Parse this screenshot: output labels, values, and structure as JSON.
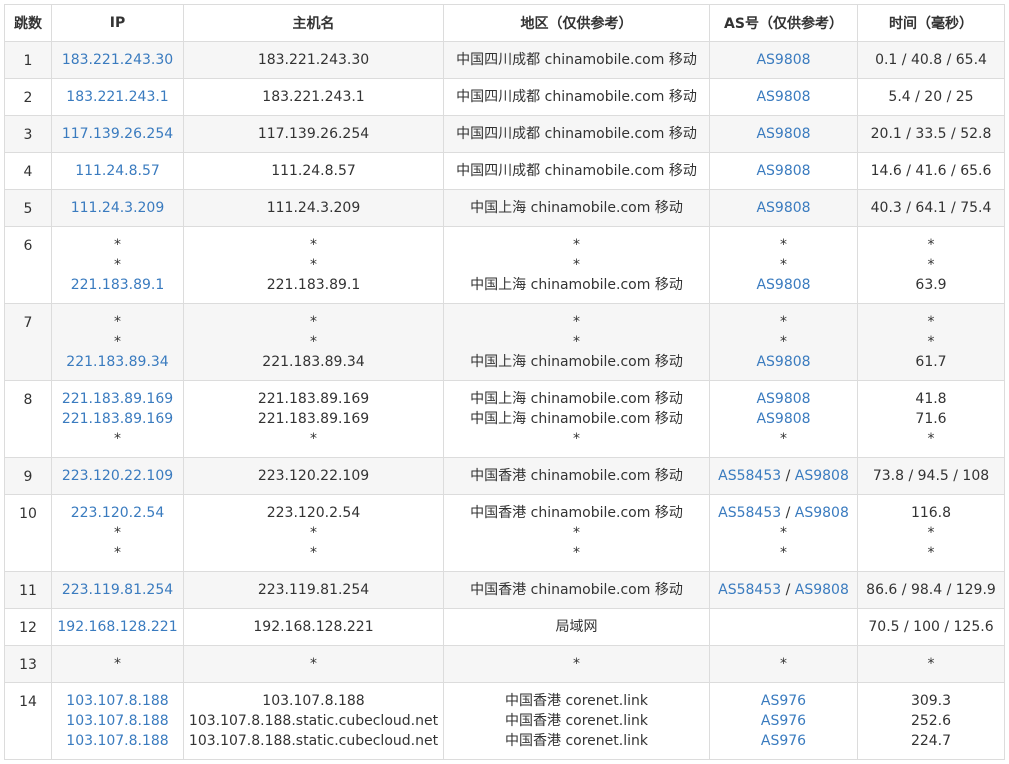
{
  "headers": {
    "hop": "跳数",
    "ip": "IP",
    "host": "主机名",
    "region": "地区（仅供参考）",
    "as": "AS号（仅供参考）",
    "time": "时间（毫秒）"
  },
  "rows": [
    {
      "hop": "1",
      "ip": [
        "183.221.243.30"
      ],
      "host": [
        "183.221.243.30"
      ],
      "region": [
        "中国四川成都 chinamobile.com 移动"
      ],
      "as": [
        [
          "AS9808"
        ]
      ],
      "time": [
        "0.1 / 40.8 / 65.4"
      ]
    },
    {
      "hop": "2",
      "ip": [
        "183.221.243.1"
      ],
      "host": [
        "183.221.243.1"
      ],
      "region": [
        "中国四川成都 chinamobile.com 移动"
      ],
      "as": [
        [
          "AS9808"
        ]
      ],
      "time": [
        "5.4 / 20 / 25"
      ]
    },
    {
      "hop": "3",
      "ip": [
        "117.139.26.254"
      ],
      "host": [
        "117.139.26.254"
      ],
      "region": [
        "中国四川成都 chinamobile.com 移动"
      ],
      "as": [
        [
          "AS9808"
        ]
      ],
      "time": [
        "20.1 / 33.5 / 52.8"
      ]
    },
    {
      "hop": "4",
      "ip": [
        "111.24.8.57"
      ],
      "host": [
        "111.24.8.57"
      ],
      "region": [
        "中国四川成都 chinamobile.com 移动"
      ],
      "as": [
        [
          "AS9808"
        ]
      ],
      "time": [
        "14.6 / 41.6 / 65.6"
      ]
    },
    {
      "hop": "5",
      "ip": [
        "111.24.3.209"
      ],
      "host": [
        "111.24.3.209"
      ],
      "region": [
        "中国上海 chinamobile.com 移动"
      ],
      "as": [
        [
          "AS9808"
        ]
      ],
      "time": [
        "40.3 / 64.1 / 75.4"
      ]
    },
    {
      "hop": "6",
      "ip": [
        "*",
        "*",
        "221.183.89.1"
      ],
      "host": [
        "*",
        "*",
        "221.183.89.1"
      ],
      "region": [
        "*",
        "*",
        "中国上海 chinamobile.com 移动"
      ],
      "as": [
        [
          "*"
        ],
        [
          "*"
        ],
        [
          "AS9808"
        ]
      ],
      "time": [
        "*",
        "*",
        "63.9"
      ]
    },
    {
      "hop": "7",
      "ip": [
        "*",
        "*",
        "221.183.89.34"
      ],
      "host": [
        "*",
        "*",
        "221.183.89.34"
      ],
      "region": [
        "*",
        "*",
        "中国上海 chinamobile.com 移动"
      ],
      "as": [
        [
          "*"
        ],
        [
          "*"
        ],
        [
          "AS9808"
        ]
      ],
      "time": [
        "*",
        "*",
        "61.7"
      ]
    },
    {
      "hop": "8",
      "ip": [
        "221.183.89.169",
        "221.183.89.169",
        "*"
      ],
      "host": [
        "221.183.89.169",
        "221.183.89.169",
        "*"
      ],
      "region": [
        "中国上海 chinamobile.com 移动",
        "中国上海 chinamobile.com 移动",
        "*"
      ],
      "as": [
        [
          "AS9808"
        ],
        [
          "AS9808"
        ],
        [
          "*"
        ]
      ],
      "time": [
        "41.8",
        "71.6",
        "*"
      ]
    },
    {
      "hop": "9",
      "ip": [
        "223.120.22.109"
      ],
      "host": [
        "223.120.22.109"
      ],
      "region": [
        "中国香港 chinamobile.com 移动"
      ],
      "as": [
        [
          "AS58453",
          "AS9808"
        ]
      ],
      "time": [
        "73.8 / 94.5 / 108"
      ]
    },
    {
      "hop": "10",
      "ip": [
        "223.120.2.54",
        "*",
        "*"
      ],
      "host": [
        "223.120.2.54",
        "*",
        "*"
      ],
      "region": [
        "中国香港 chinamobile.com 移动",
        "*",
        "*"
      ],
      "as": [
        [
          "AS58453",
          "AS9808"
        ],
        [
          "*"
        ],
        [
          "*"
        ]
      ],
      "time": [
        "116.8",
        "*",
        "*"
      ]
    },
    {
      "hop": "11",
      "ip": [
        "223.119.81.254"
      ],
      "host": [
        "223.119.81.254"
      ],
      "region": [
        "中国香港 chinamobile.com 移动"
      ],
      "as": [
        [
          "AS58453",
          "AS9808"
        ]
      ],
      "time": [
        "86.6 / 98.4 / 129.9"
      ]
    },
    {
      "hop": "12",
      "ip": [
        "192.168.128.221"
      ],
      "host": [
        "192.168.128.221"
      ],
      "region": [
        "局域网"
      ],
      "as": [
        []
      ],
      "time": [
        "70.5 / 100 / 125.6"
      ]
    },
    {
      "hop": "13",
      "ip": [
        "*"
      ],
      "host": [
        "*"
      ],
      "region": [
        "*"
      ],
      "as": [
        [
          "*"
        ]
      ],
      "time": [
        "*"
      ]
    },
    {
      "hop": "14",
      "ip": [
        "103.107.8.188",
        "103.107.8.188",
        "103.107.8.188"
      ],
      "host": [
        "103.107.8.188",
        "103.107.8.188.static.cubecloud.net",
        "103.107.8.188.static.cubecloud.net"
      ],
      "region": [
        "中国香港 corenet.link",
        "中国香港 corenet.link",
        "中国香港 corenet.link"
      ],
      "as": [
        [
          "AS976"
        ],
        [
          "AS976"
        ],
        [
          "AS976"
        ]
      ],
      "time": [
        "309.3",
        "252.6",
        "224.7"
      ]
    }
  ]
}
